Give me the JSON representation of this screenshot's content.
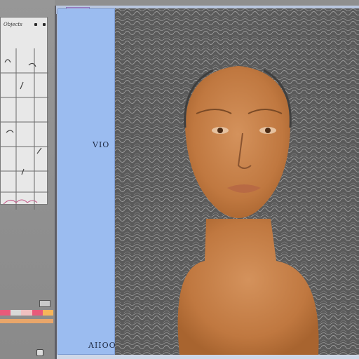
{
  "sidebar": {
    "panel_title": "Objects",
    "swatches": [
      "#e85a7a",
      "#d8d8d8",
      "#f0c0c0",
      "#e85a7a",
      "#f7b55a"
    ],
    "secondary_strip": "#e9a66a"
  },
  "canvas": {
    "tab_color": "#d8c6ef",
    "label_upper": "VIO",
    "label_lower": "AIIOO"
  },
  "artwork": {
    "subject": "portrait",
    "hair_color": "#5a5a5a",
    "skin_color": "#c8834f"
  }
}
